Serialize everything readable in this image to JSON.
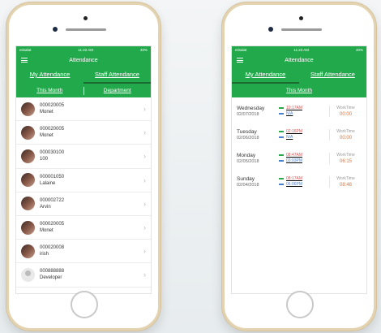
{
  "status": {
    "carrier": "etisalat",
    "time": "11:22 AM",
    "battery": "40%"
  },
  "status_right": {
    "carrier": "etisalat",
    "time": "11:23 AM",
    "battery": "40%"
  },
  "nav": {
    "title": "Attendance"
  },
  "tabs": [
    "My Attendance",
    "Staff Attendance"
  ],
  "left": {
    "subtabs": [
      "This Month",
      "Department"
    ],
    "staff": [
      {
        "id": "000020005",
        "name": "Monet",
        "avatar": "photo"
      },
      {
        "id": "000020005",
        "name": "Monet",
        "avatar": "photo"
      },
      {
        "id": "000030100",
        "name": "100",
        "avatar": "photo"
      },
      {
        "id": "000001050",
        "name": "Lalaine",
        "avatar": "photo"
      },
      {
        "id": "000002722",
        "name": "Arvin",
        "avatar": "photo"
      },
      {
        "id": "000020005",
        "name": "Monet",
        "avatar": "photo"
      },
      {
        "id": "000020008",
        "name": "irish",
        "avatar": "photo"
      },
      {
        "id": "000888888",
        "name": "Developer",
        "avatar": "placeholder"
      }
    ]
  },
  "right": {
    "subtab": "This Month",
    "days": [
      {
        "day": "Wednesday",
        "date": "02/07/2018",
        "in": "10:17AM",
        "out": "N/A",
        "worktime_label": "WorkTime",
        "worktime": "00:00"
      },
      {
        "day": "Tuesday",
        "date": "02/06/2018",
        "in": "02:16PM",
        "out": "N/A",
        "worktime_label": "WorkTime",
        "worktime": "00:00"
      },
      {
        "day": "Monday",
        "date": "02/05/2018",
        "in": "08:47AM",
        "out": "03:03PM",
        "worktime_label": "WorkTime",
        "worktime": "06:15"
      },
      {
        "day": "Sunday",
        "date": "02/04/2018",
        "in": "08:17AM",
        "out": "06:06PM",
        "worktime_label": "WorkTime",
        "worktime": "08:48"
      }
    ]
  },
  "colors": {
    "green": "#22a94b",
    "in": "#e05050",
    "out": "#4a7fd0",
    "worktime": "#e07030"
  }
}
